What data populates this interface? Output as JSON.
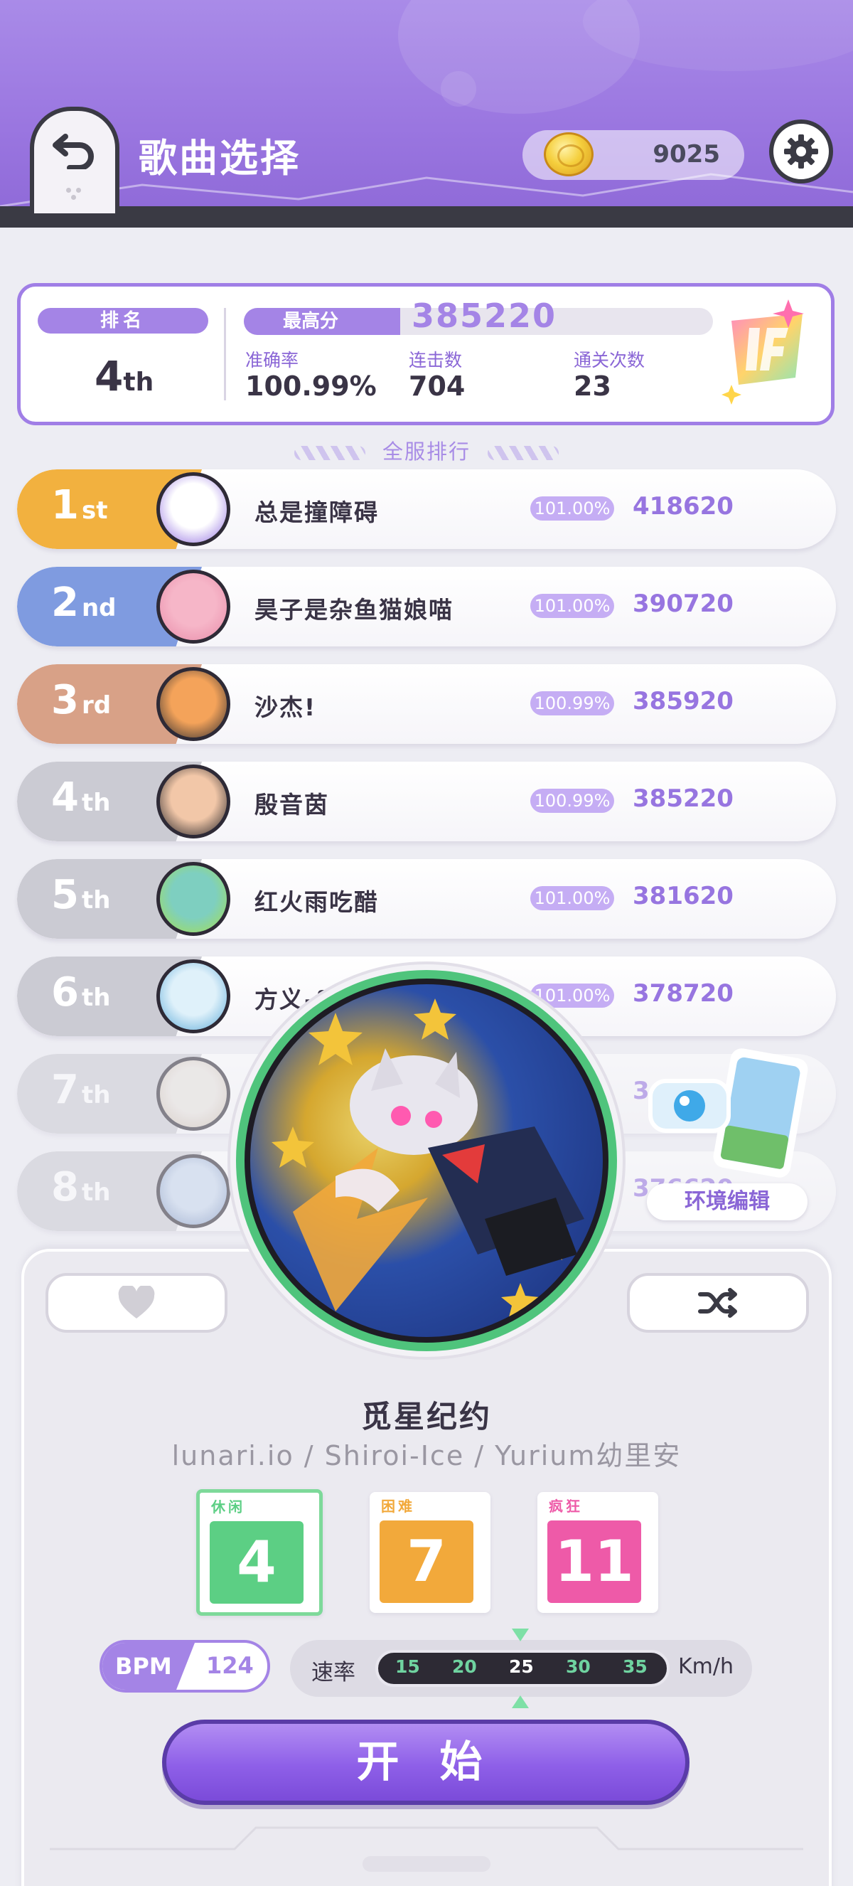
{
  "header": {
    "title": "歌曲选择",
    "coins": "9025"
  },
  "my_score": {
    "rank_label": "排名",
    "rank_number": "4",
    "rank_suffix": "th",
    "best_label": "最高分",
    "best_score": "385220",
    "accuracy_label": "准确率",
    "accuracy": "100.99%",
    "combo_label": "连击数",
    "combo": "704",
    "clears_label": "通关次数",
    "clears": "23"
  },
  "server_rank_label": "全服排行",
  "leaderboard": [
    {
      "rank": "1",
      "suffix": "st",
      "name": "总是撞障碍",
      "accuracy": "101.00%",
      "score": "418620",
      "color": "#f2b13f"
    },
    {
      "rank": "2",
      "suffix": "nd",
      "name": "昊子是杂鱼猫娘喵",
      "accuracy": "101.00%",
      "score": "390720",
      "color": "#7f9be0"
    },
    {
      "rank": "3",
      "suffix": "rd",
      "name": "沙杰!",
      "accuracy": "100.99%",
      "score": "385920",
      "color": "#d8a187"
    },
    {
      "rank": "4",
      "suffix": "th",
      "name": "殷音茵",
      "accuracy": "100.99%",
      "score": "385220",
      "color": "#cbcbd3"
    },
    {
      "rank": "5",
      "suffix": "th",
      "name": "红火雨吃醋",
      "accuracy": "101.00%",
      "score": "381620",
      "color": "#cbcbd3"
    },
    {
      "rank": "6",
      "suffix": "th",
      "name": "方义-fy",
      "accuracy": "101.00%",
      "score": "378720",
      "color": "#cbcbd3"
    },
    {
      "rank": "7",
      "suffix": "th",
      "name": "",
      "accuracy": "",
      "score": "3",
      "color": "#cbcbd3"
    },
    {
      "rank": "8",
      "suffix": "th",
      "name": "",
      "accuracy": "",
      "score": "376620",
      "color": "#cbcbd3"
    }
  ],
  "env_edit_label": "环境编辑",
  "song": {
    "title": "觅星纪约",
    "artist": "lunari.io / Shiroi-Ice / Yurium幼里安"
  },
  "difficulties": [
    {
      "tag": "休闲",
      "level": "4",
      "color": "#5ccf84",
      "selected": true
    },
    {
      "tag": "困难",
      "level": "7",
      "color": "#f2a93b",
      "selected": false
    },
    {
      "tag": "疯狂",
      "level": "11",
      "color": "#ee5aa8",
      "selected": false
    }
  ],
  "bpm": {
    "label": "BPM",
    "value": "124"
  },
  "speed": {
    "label": "速率",
    "options": [
      "15",
      "20",
      "25",
      "30",
      "35"
    ],
    "selected": "25",
    "unit": "Km/h"
  },
  "start_label": "开 始"
}
